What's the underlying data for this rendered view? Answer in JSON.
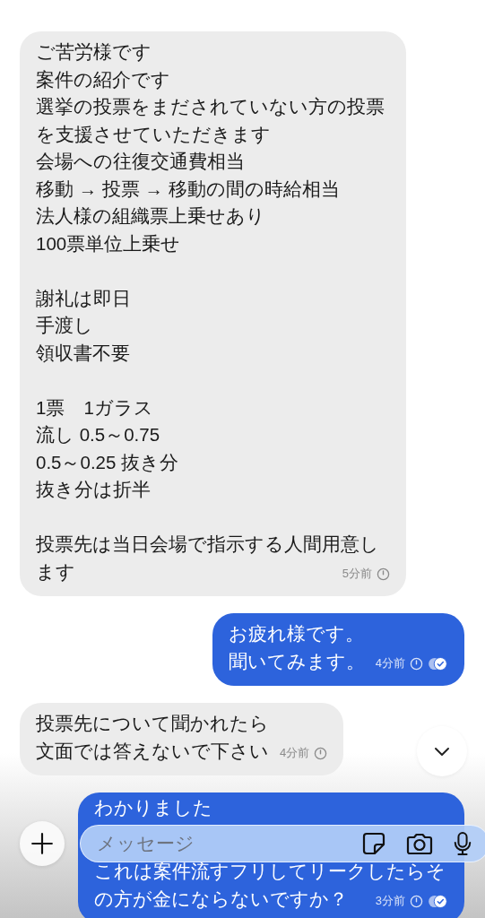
{
  "messages": [
    {
      "kind": "received",
      "paragraphs": [
        [
          "ご苦労様です",
          "案件の紹介です",
          "選挙の投票をまだされていない方の投票を支援させていただきます",
          "会場への往復交通費相当",
          "移動 → 投票 → 移動の間の時給相当",
          "法人様の組織票上乗せあり",
          "100票単位上乗せ"
        ],
        [
          "謝礼は即日",
          "手渡し",
          "領収書不要"
        ],
        [
          "1票　1ガラス",
          "流し 0.5～0.75",
          "0.5～0.25 抜き分",
          "抜き分は折半"
        ],
        [
          "投票先は当日会場で指示する人間用意し",
          "ます"
        ]
      ],
      "time": "5分前",
      "read": false
    },
    {
      "kind": "sent",
      "paragraphs": [
        [
          "お疲れ様です。",
          "聞いてみます。"
        ]
      ],
      "time": "4分前",
      "read": true
    },
    {
      "kind": "received",
      "paragraphs": [
        [
          "投票先について聞かれたら",
          "文面では答えないで下さい"
        ]
      ],
      "time": "4分前",
      "read": false
    },
    {
      "kind": "sent",
      "paragraphs": [
        [
          "わかりました"
        ],
        [
          "これは案件流すフリしてリークしたらそ",
          "の方が金にならないですか？"
        ]
      ],
      "time": "3分前",
      "read": true
    }
  ],
  "composer": {
    "placeholder": "メッセージ"
  }
}
